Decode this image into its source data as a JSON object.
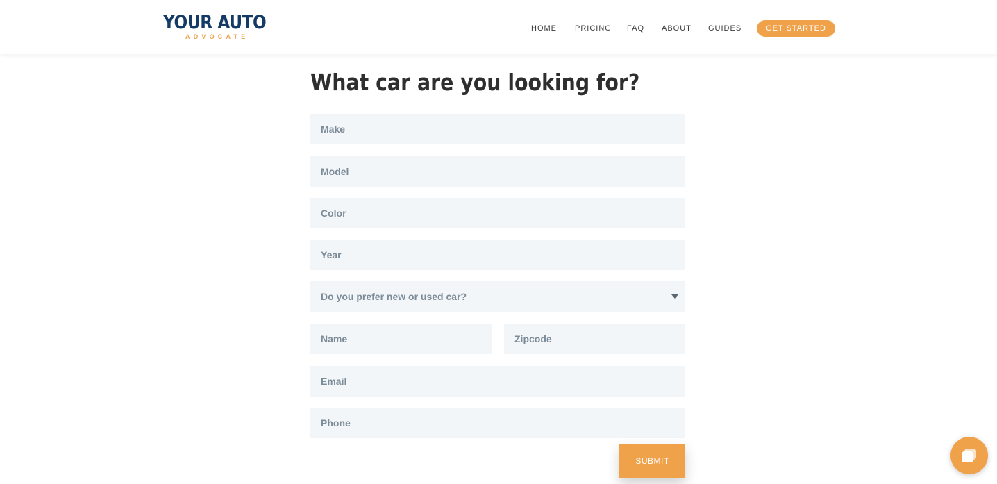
{
  "logo": {
    "main": "YOUR AUTO",
    "sub": "ADVOCATE"
  },
  "nav": {
    "items": [
      "HOME",
      "PRICING",
      "FAQ",
      "ABOUT",
      "GUIDES"
    ],
    "cta": "GET STARTED"
  },
  "form": {
    "title": "What car are you looking for?",
    "make_placeholder": "Make",
    "model_placeholder": "Model",
    "color_placeholder": "Color",
    "year_placeholder": "Year",
    "condition_select": "Do you prefer new or used car?",
    "name_placeholder": "Name",
    "zipcode_placeholder": "Zipcode",
    "email_placeholder": "Email",
    "phone_placeholder": "Phone",
    "submit_label": "SUBMIT"
  },
  "colors": {
    "brand_navy": "#143a66",
    "accent_orange": "#f0a24b",
    "field_background": "#f3f6f8",
    "placeholder_text": "#7c8b98"
  },
  "icons": {
    "select_arrow": "chevron-down-icon",
    "chat": "chat-bubble-icon"
  }
}
